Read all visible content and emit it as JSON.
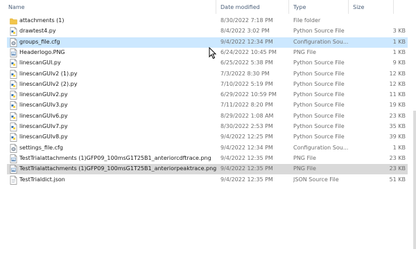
{
  "columns": {
    "name": "Name",
    "date_modified": "Date modified",
    "type": "Type",
    "size": "Size"
  },
  "files": [
    {
      "name": "attachments (1)",
      "date": "8/30/2022 7:18 PM",
      "type": "File folder",
      "size": "",
      "icon": "folder-icon"
    },
    {
      "name": "drawtest4.py",
      "date": "8/4/2022 3:02 PM",
      "type": "Python Source File",
      "size": "3 KB",
      "icon": "python-file-icon"
    },
    {
      "name": "groups_file.cfg",
      "date": "9/4/2022 12:34 PM",
      "type": "Configuration Sou...",
      "size": "1 KB",
      "icon": "config-file-icon"
    },
    {
      "name": "Headerlogo.PNG",
      "date": "6/24/2022 10:45 PM",
      "type": "PNG File",
      "size": "1 KB",
      "icon": "image-file-icon"
    },
    {
      "name": "linescanGUI.py",
      "date": "6/25/2022 5:38 PM",
      "type": "Python Source File",
      "size": "9 KB",
      "icon": "python-file-icon"
    },
    {
      "name": "linescanGUIv2 (1).py",
      "date": "7/3/2022 8:30 PM",
      "type": "Python Source File",
      "size": "12 KB",
      "icon": "python-file-icon"
    },
    {
      "name": "linescanGUIv2 (2).py",
      "date": "7/10/2022 5:19 PM",
      "type": "Python Source File",
      "size": "12 KB",
      "icon": "python-file-icon"
    },
    {
      "name": "linescanGUIv2.py",
      "date": "6/29/2022 10:59 PM",
      "type": "Python Source File",
      "size": "11 KB",
      "icon": "python-file-icon"
    },
    {
      "name": "linescanGUIv3.py",
      "date": "7/11/2022 8:20 PM",
      "type": "Python Source File",
      "size": "19 KB",
      "icon": "python-file-icon"
    },
    {
      "name": "linescanGUIv6.py",
      "date": "8/29/2022 1:08 AM",
      "type": "Python Source File",
      "size": "23 KB",
      "icon": "python-file-icon"
    },
    {
      "name": "linescanGUIv7.py",
      "date": "8/30/2022 2:53 PM",
      "type": "Python Source File",
      "size": "35 KB",
      "icon": "python-file-icon"
    },
    {
      "name": "linescanGUIv8.py",
      "date": "9/4/2022 12:25 PM",
      "type": "Python Source File",
      "size": "39 KB",
      "icon": "python-file-icon"
    },
    {
      "name": "settings_file.cfg",
      "date": "9/4/2022 12:34 PM",
      "type": "Configuration Sou...",
      "size": "1 KB",
      "icon": "config-file-icon"
    },
    {
      "name": "TestTrialattachments (1)GFP09_100msG1T25B1_anteriorcdftrace.png",
      "date": "9/4/2022 12:35 PM",
      "type": "PNG File",
      "size": "23 KB",
      "icon": "image-file-icon"
    },
    {
      "name": "TestTrialattachments (1)GFP09_100msG1T25B1_anteriorpeaktrace.png",
      "date": "9/4/2022 12:35 PM",
      "type": "PNG File",
      "size": "23 KB",
      "icon": "image-file-icon"
    },
    {
      "name": "TestTrialdict.json",
      "date": "9/4/2022 12:35 PM",
      "type": "JSON Source File",
      "size": "51 KB",
      "icon": "json-file-icon"
    }
  ],
  "selected_row": 2,
  "highlighted_row": 14,
  "colors": {
    "selection": "#cce8ff",
    "highlight": "#d9d9d9",
    "folder": "#f2c54a",
    "python_blue": "#3a75b0",
    "python_yellow": "#f5d44a"
  }
}
